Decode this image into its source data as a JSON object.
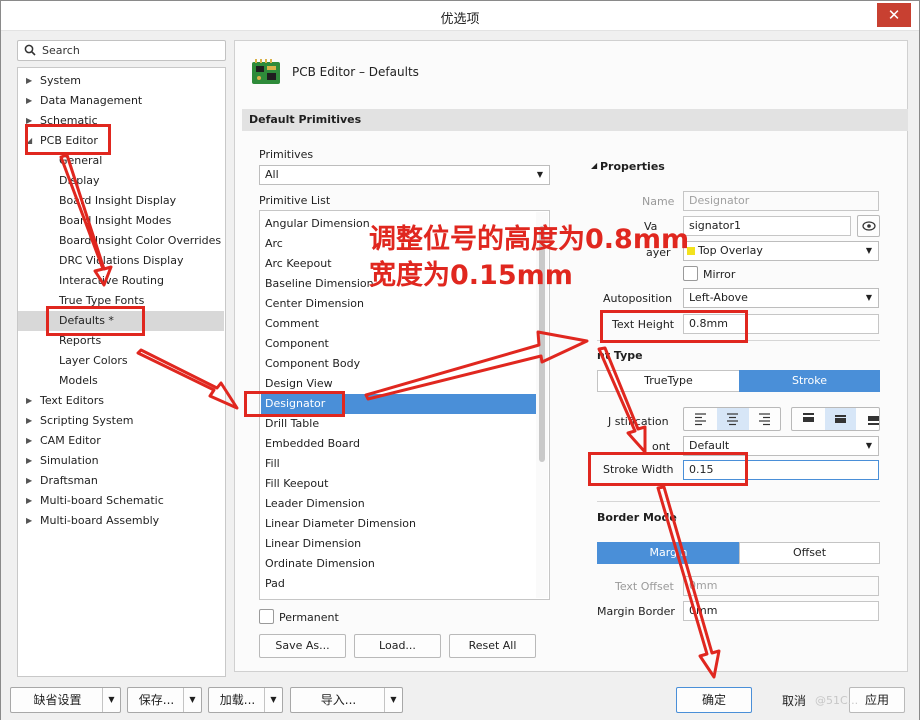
{
  "window": {
    "title": "优选项",
    "close_glyph": "✕"
  },
  "search": {
    "placeholder": "Search"
  },
  "tree": [
    {
      "label": "System",
      "has_arrow": true
    },
    {
      "label": "Data Management",
      "has_arrow": true
    },
    {
      "label": "Schematic",
      "has_arrow": true
    },
    {
      "label": "PCB Editor",
      "expanded": true
    },
    {
      "label": "General"
    },
    {
      "label": "Display"
    },
    {
      "label": "Board Insight Display"
    },
    {
      "label": "Board Insight Modes"
    },
    {
      "label": "Board Insight Color Overrides"
    },
    {
      "label": "DRC Violations Display"
    },
    {
      "label": "Interactive Routing"
    },
    {
      "label": "True Type Fonts"
    },
    {
      "label": "Defaults *",
      "selected": true
    },
    {
      "label": "Reports"
    },
    {
      "label": "Layer Colors"
    },
    {
      "label": "Models"
    },
    {
      "label": "Text Editors",
      "has_arrow": true
    },
    {
      "label": "Scripting System",
      "has_arrow": true
    },
    {
      "label": "CAM Editor",
      "has_arrow": true
    },
    {
      "label": "Simulation",
      "has_arrow": true
    },
    {
      "label": "Draftsman",
      "has_arrow": true
    },
    {
      "label": "Multi-board Schematic",
      "has_arrow": true
    },
    {
      "label": "Multi-board Assembly",
      "has_arrow": true
    }
  ],
  "page": {
    "title": "PCB Editor – Defaults",
    "section": "Default Primitives"
  },
  "primitives": {
    "label": "Primitives",
    "selected": "All",
    "list_label": "Primitive List",
    "items": [
      "Angular Dimension",
      "Arc",
      "Arc Keepout",
      "Baseline Dimension",
      "Center Dimension",
      "Comment",
      "Component",
      "Component Body",
      "Design View",
      "Designator",
      "Drill Table",
      "Embedded Board",
      "Fill",
      "Fill Keepout",
      "Leader Dimension",
      "Linear Diameter Dimension",
      "Linear Dimension",
      "Ordinate Dimension",
      "Pad"
    ],
    "selected_index": 9,
    "permanent_label": "Permanent",
    "save_as": "Save As...",
    "load": "Load...",
    "reset_all": "Reset All"
  },
  "properties": {
    "header": "Properties",
    "name_label": "Name",
    "name_value": "Designator",
    "value_label": "Va",
    "value_value": "signator1",
    "layer_label": "ayer",
    "layer_value": "Top Overlay",
    "mirror_label": "Mirror",
    "autoposition_label": "Autoposition",
    "autoposition_value": "Left-Above",
    "text_height_label": "Text Height",
    "text_height_value": "0.8mm",
    "font_type_header": "nt Type",
    "font_type_options": [
      "TrueType",
      "Stroke"
    ],
    "font_type_selected": "Stroke",
    "justification_label": "J stification",
    "font_label": "ont",
    "font_value": "Default",
    "stroke_width_label": "Stroke Width",
    "stroke_width_value": "0.15",
    "border_mode_header": "Border Mode",
    "border_mode_options": [
      "Marg n",
      "Offset"
    ],
    "border_mode_selected": "Marg n",
    "text_offset_label": "Text Offset",
    "text_offset_value": "0mm",
    "margin_border_label": "Margin Border",
    "margin_border_value": "0mm"
  },
  "annotation": {
    "line1": "调整位号的高度为0.8mm",
    "line2": "宽度为0.15mm",
    "color": "#e0271f"
  },
  "bottom": {
    "defaults_btn": "缺省设置",
    "save_btn": "保存...",
    "load_btn": "加载...",
    "import_btn": "导入...",
    "ok_btn": "确定",
    "cancel_btn": "取消",
    "apply_btn": "应用",
    "watermark": "@51C..."
  },
  "colors": {
    "accent": "#4a8fd8",
    "close": "#c84031",
    "annotation": "#e0271f"
  }
}
